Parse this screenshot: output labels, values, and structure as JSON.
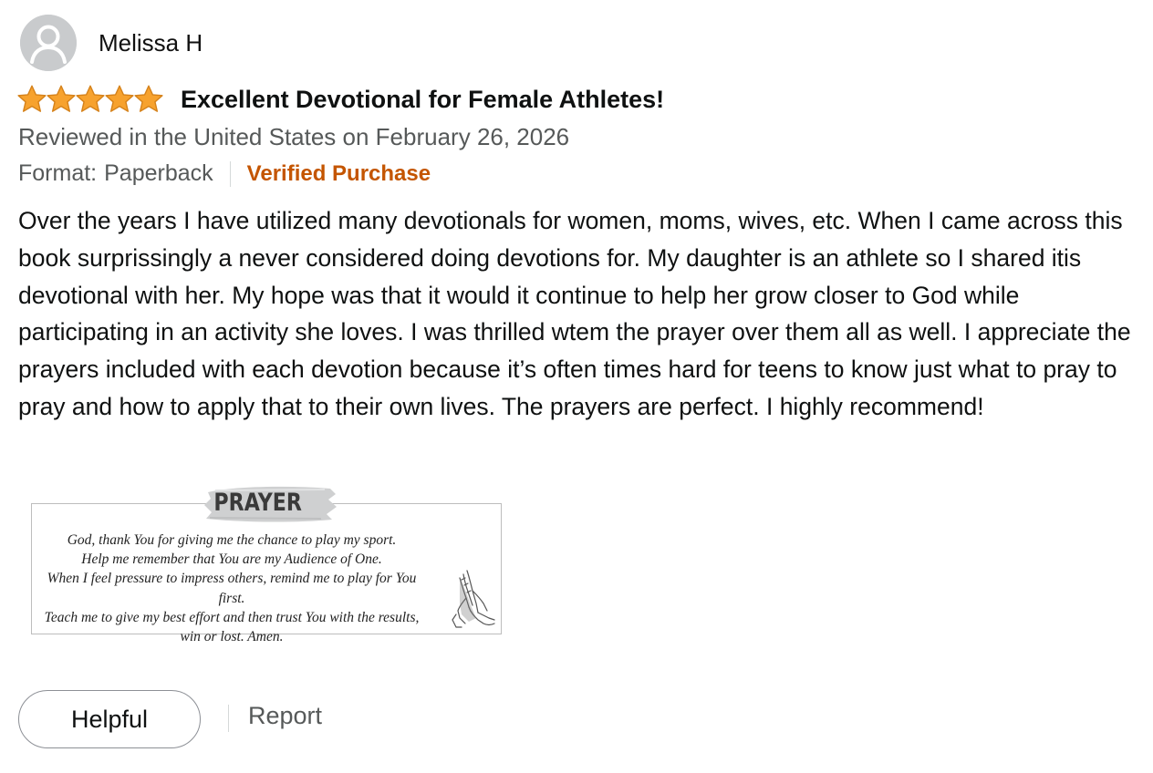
{
  "reviewer": {
    "name": "Melissa H",
    "avatar_icon": "user-silhouette-icon"
  },
  "rating": {
    "stars": 5,
    "max_stars": 5,
    "star_color": "#f7a22e",
    "star_icon": "star-icon"
  },
  "review": {
    "title": "Excellent Devotional for Female Athletes!",
    "date_line": "Reviewed in the United States on February 26, 2026",
    "format_label": "Format:",
    "format_value": "Paperback",
    "verified_label": "Verified Purchase",
    "verified_color": "#c45500",
    "body": "Over the years I have utilized many devotionals for women, moms, wives, etc. When I came across this book surprissingly a never considered doing devotions for. My daughter is an athlete so I shared itis devotional with her. My hope was that it would it continue to help her grow closer to God while participating in an activity she loves. I was thrilled wtem the prayer over them all as well. I appreciate the prayers included with each devotion because it’s often times hard for teens to know just what to pray to pray and how to apply that to their own lives. The prayers are perfect. I highly recommend!"
  },
  "review_image": {
    "heading": "PRAYER",
    "lines": [
      "God, thank You for giving me the chance to play my sport.",
      "Help me remember that You are my Audience of One.",
      "When I feel pressure to impress others, remind me to play for You first.",
      "Teach me to give my best effort and then trust You with the results,",
      "win or lost. Amen."
    ],
    "decoration_icon": "praying-hands-icon"
  },
  "actions": {
    "helpful_label": "Helpful",
    "report_label": "Report"
  }
}
